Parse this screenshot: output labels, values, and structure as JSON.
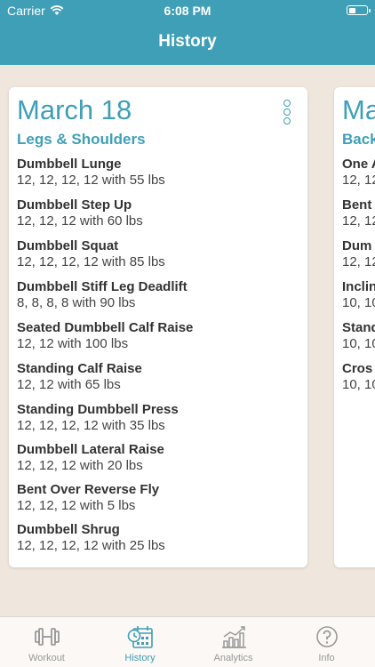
{
  "status": {
    "carrier": "Carrier",
    "time": "6:08 PM"
  },
  "nav": {
    "title": "History"
  },
  "cards": [
    {
      "date": "March 18",
      "group": "Legs & Shoulders",
      "exercises": [
        {
          "name": "Dumbbell Lunge",
          "sets": "12, 12, 12, 12 with 55 lbs"
        },
        {
          "name": "Dumbbell Step Up",
          "sets": "12, 12, 12 with 60 lbs"
        },
        {
          "name": "Dumbbell Squat",
          "sets": "12, 12, 12, 12 with 85 lbs"
        },
        {
          "name": "Dumbbell Stiff Leg Deadlift",
          "sets": "8, 8, 8, 8 with 90 lbs"
        },
        {
          "name": "Seated Dumbbell Calf Raise",
          "sets": "12, 12 with 100 lbs"
        },
        {
          "name": "Standing Calf Raise",
          "sets": "12, 12 with 65 lbs"
        },
        {
          "name": "Standing Dumbbell Press",
          "sets": "12, 12, 12, 12 with 35 lbs"
        },
        {
          "name": "Dumbbell Lateral Raise",
          "sets": "12, 12, 12 with 20 lbs"
        },
        {
          "name": "Bent Over Reverse Fly",
          "sets": "12, 12, 12 with 5 lbs"
        },
        {
          "name": "Dumbbell Shrug",
          "sets": "12, 12, 12, 12 with 25 lbs"
        }
      ]
    },
    {
      "date": "Ma",
      "group": "Back",
      "exercises": [
        {
          "name": "One A",
          "sets": "12, 12"
        },
        {
          "name": "Bent",
          "sets": "12, 12"
        },
        {
          "name": "Dum",
          "sets": "12, 12"
        },
        {
          "name": "Inclin",
          "sets": "10, 10"
        },
        {
          "name": "Stand",
          "sets": "10, 10"
        },
        {
          "name": "Cros",
          "sets": "10, 10"
        }
      ]
    }
  ],
  "tabs": [
    {
      "label": "Workout",
      "icon": "dumbbell-icon"
    },
    {
      "label": "History",
      "icon": "calendar-clock-icon",
      "active": true
    },
    {
      "label": "Analytics",
      "icon": "chart-icon"
    },
    {
      "label": "Info",
      "icon": "question-icon"
    }
  ],
  "colors": {
    "accent": "#3f9fb7",
    "background": "#efe6dd",
    "inactive": "#999999"
  }
}
